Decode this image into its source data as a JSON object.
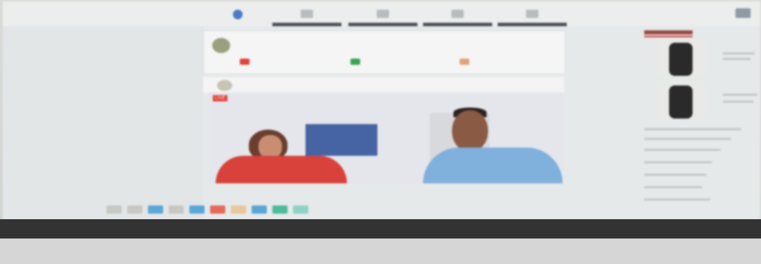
{
  "nav": {
    "tabs": [
      {
        "icon": "home-icon",
        "active": true
      },
      {
        "icon": "network-icon",
        "active": false
      },
      {
        "icon": "jobs-icon",
        "active": false
      },
      {
        "icon": "messaging-icon",
        "active": false
      },
      {
        "icon": "notifications-icon",
        "active": false
      }
    ],
    "menu_icon": "grid-icon"
  },
  "composer": {
    "prompt": "",
    "actions": [
      {
        "label": "",
        "color": "#e0443b"
      },
      {
        "label": "",
        "color": "#3aa350"
      },
      {
        "label": "",
        "color": "#e5a07a"
      }
    ]
  },
  "post": {
    "author": "",
    "video": {
      "badge": "LIVE",
      "participants": 2
    }
  },
  "sidebar": {
    "title": "",
    "accent_color": "#c23a32"
  },
  "taskbar": {
    "icons": [
      "#c7c8c3",
      "#c7c8c3",
      "#5aa7d6",
      "#c7c8c3",
      "#5aa7d6",
      "#e46b5c",
      "#e8c79a",
      "#5aa7d6",
      "#4dbb9c",
      "#8fd2c4"
    ]
  }
}
